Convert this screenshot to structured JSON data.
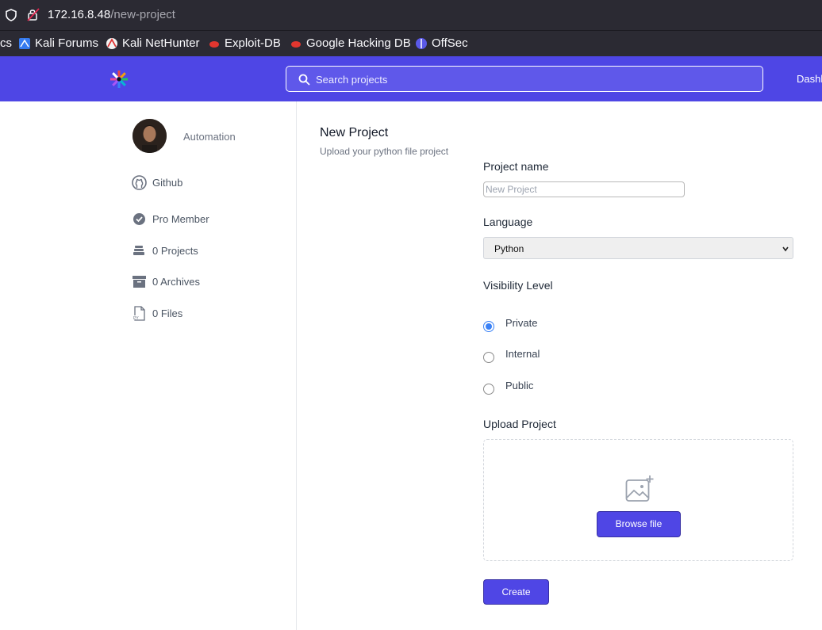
{
  "browser": {
    "url_host": "172.16.8.48",
    "url_path": "/new-project",
    "bookmarks": [
      "cs",
      "Kali Forums",
      "Kali NetHunter",
      "Exploit-DB",
      "Google Hacking DB",
      "OffSec"
    ]
  },
  "header": {
    "search_placeholder": "Search projects",
    "nav_dashboard": "Dashb",
    "accent_color": "#4e46e5"
  },
  "sidebar": {
    "username": "Automation",
    "items": [
      {
        "label": "Github",
        "icon": "github-icon"
      },
      {
        "label": "Pro Member",
        "icon": "check-badge-icon"
      },
      {
        "label": "0 Projects",
        "icon": "stack-icon"
      },
      {
        "label": "0 Archives",
        "icon": "archive-box-icon"
      },
      {
        "label": "0 Files",
        "icon": "python-file-icon"
      }
    ]
  },
  "form": {
    "title": "New Project",
    "subtitle": "Upload your python file project",
    "project_name_label": "Project name",
    "project_name_placeholder": "New Project",
    "project_name_value": "",
    "language_label": "Language",
    "language_value": "Python",
    "visibility_label": "Visibility Level",
    "visibility_options": [
      {
        "label": "Private",
        "selected": true
      },
      {
        "label": "Internal",
        "selected": false
      },
      {
        "label": "Public",
        "selected": false
      }
    ],
    "upload_label": "Upload Project",
    "browse_label": "Browse file",
    "create_label": "Create"
  }
}
